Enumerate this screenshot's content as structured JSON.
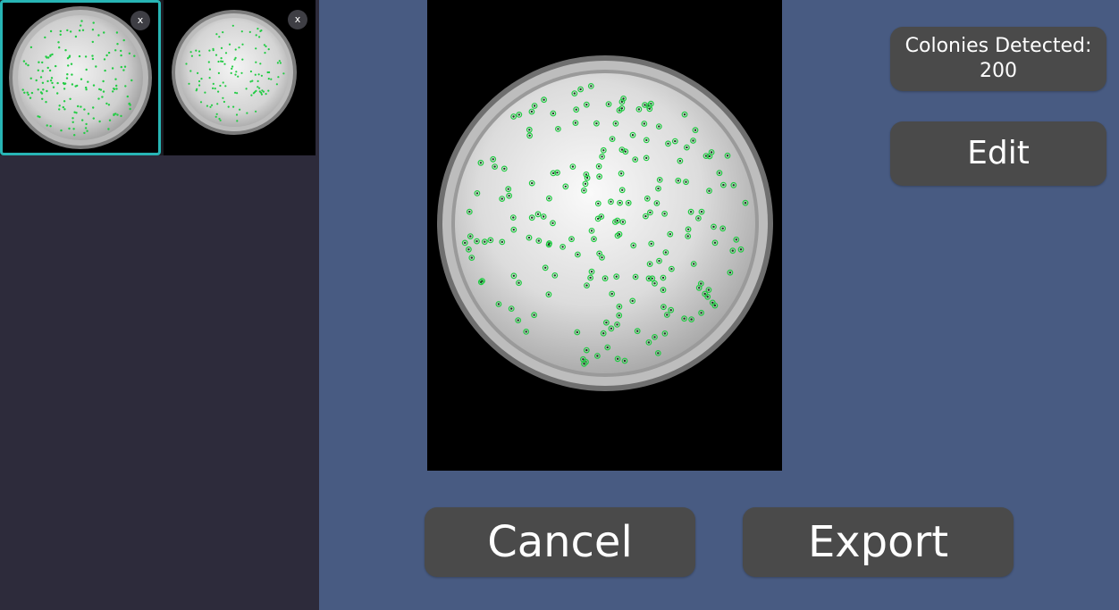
{
  "thumbnails": [
    {
      "selected": true,
      "close_label": "x"
    },
    {
      "selected": false,
      "close_label": "x"
    }
  ],
  "results": {
    "label": "Colonies Detected:",
    "count": "200"
  },
  "buttons": {
    "edit": "Edit",
    "cancel": "Cancel",
    "export": "Export"
  },
  "colors": {
    "background": "#485b82",
    "sidebar": "#2d2b3b",
    "selection_border": "#27b5b5",
    "button": "#4a4a4a",
    "colony_marker": "#22cc44"
  }
}
